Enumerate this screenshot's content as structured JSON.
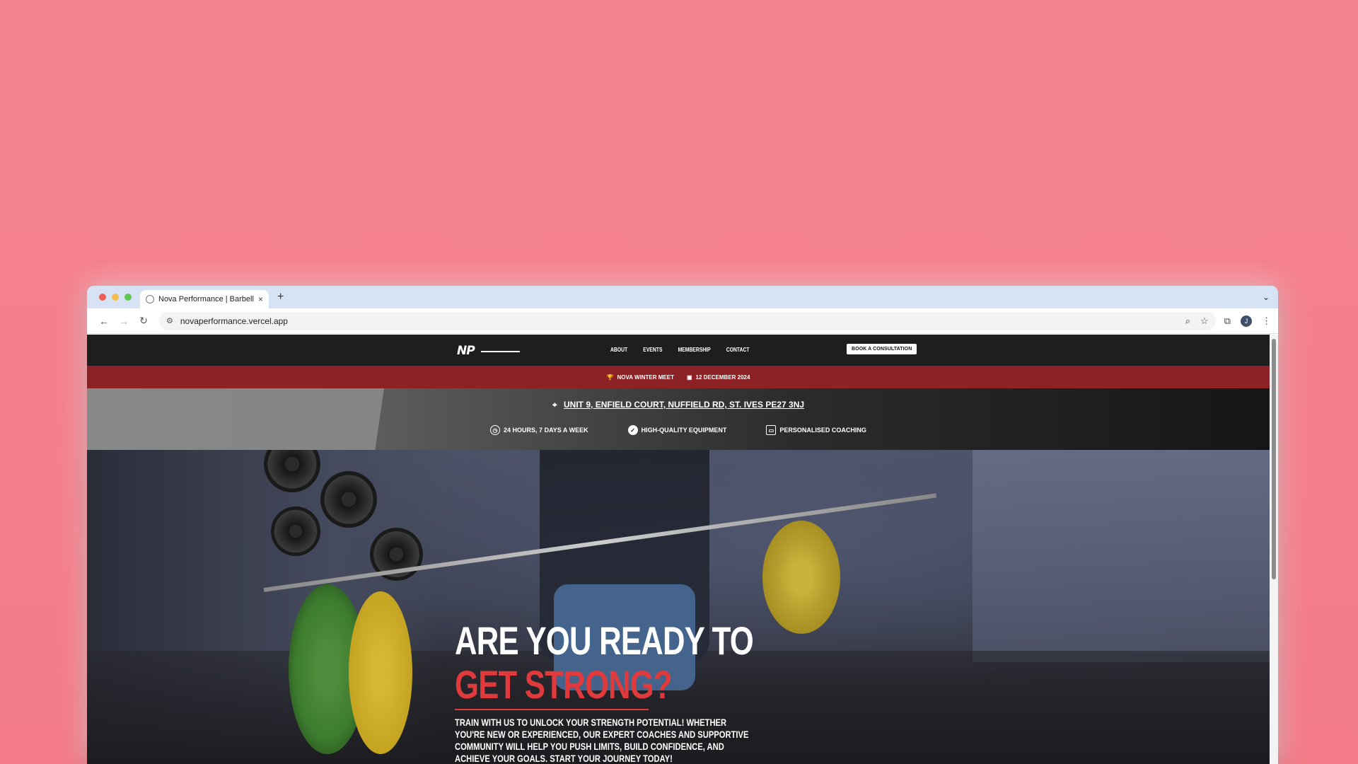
{
  "browser": {
    "tab_title": "Nova Performance | Barbell C",
    "tab_close": "×",
    "new_tab": "+",
    "tab_menu": "⌄",
    "url": "novaperformance.vercel.app",
    "avatar_initial": "J"
  },
  "site": {
    "logo": "NP",
    "nav": [
      "ABOUT",
      "EVENTS",
      "MEMBERSHIP",
      "CONTACT"
    ],
    "cta": "BOOK A CONSULTATION",
    "promo": {
      "event": "NOVA WINTER MEET",
      "date": "12 DECEMBER 2024"
    },
    "address": "UNIT 9, ENFIELD COURT, NUFFIELD RD, ST. IVES PE27 3NJ",
    "features": [
      {
        "icon": "clock-icon",
        "label": "24 HOURS, 7 DAYS A WEEK"
      },
      {
        "icon": "check-circle-icon",
        "label": "HIGH-QUALITY EQUIPMENT"
      },
      {
        "icon": "coaching-icon",
        "label": "PERSONALISED COACHING"
      }
    ],
    "hero": {
      "headline_1": "ARE YOU READY TO",
      "headline_2": "GET STRONG?",
      "description": "TRAIN WITH US TO UNLOCK YOUR STRENGTH POTENTIAL! WHETHER YOU'RE NEW OR EXPERIENCED, OUR EXPERT COACHES AND SUPPORTIVE COMMUNITY WILL HELP YOU PUSH LIMITS, BUILD CONFIDENCE, AND ACHIEVE YOUR GOALS. START YOUR JOURNEY TODAY!"
    }
  },
  "colors": {
    "background": "#f47f8c",
    "promo_bar": "#8c2225",
    "accent_red": "#e03a3c",
    "nav_bg": "#1e1e1e"
  }
}
